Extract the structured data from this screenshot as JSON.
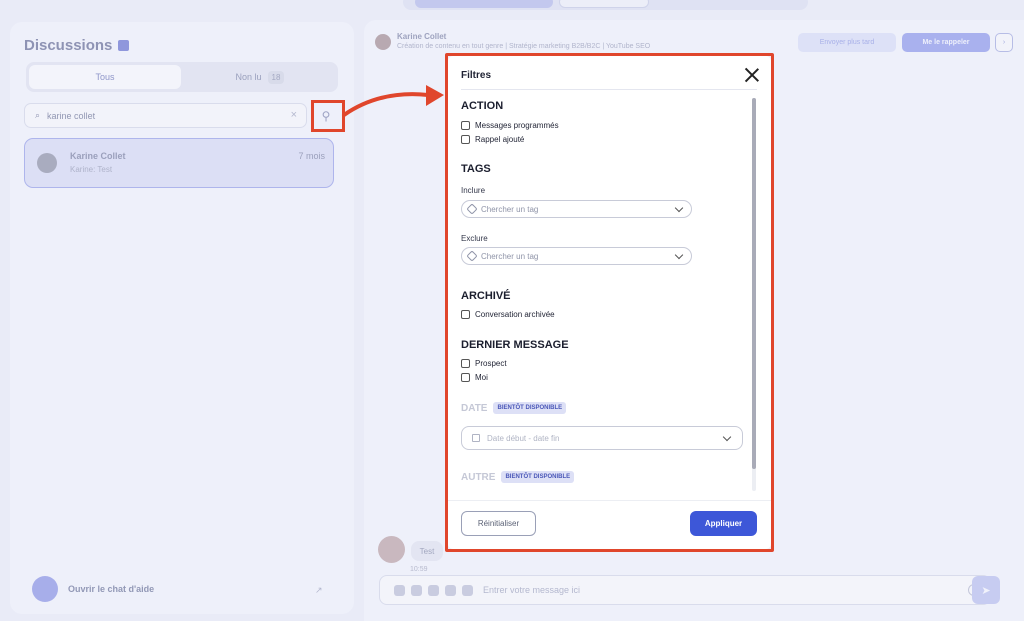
{
  "sidebar": {
    "title": "Discussions",
    "tabs": [
      {
        "label": "Tous"
      },
      {
        "label": "Non lu",
        "count": "18"
      }
    ],
    "search_value": "karine collet",
    "contact": {
      "name": "Karine Collet",
      "preview": "Karine: Test",
      "time": "7 mois"
    },
    "help_label": "Ouvrir le chat d'aide"
  },
  "chat": {
    "contact_name": "Karine Collet",
    "contact_subtitle": "Création de contenu en tout genre | Stratégie marketing B2B/B2C | YouTube SEO",
    "later_button": "Envoyer plus tard",
    "remind_button": "Me le rappeler",
    "message_text": "Test",
    "message_time": "10:59",
    "composer_placeholder": "Entrer votre message ici"
  },
  "filters": {
    "title": "Filtres",
    "action": {
      "title": "ACTION",
      "options": [
        "Messages programmés",
        "Rappel ajouté"
      ]
    },
    "tags": {
      "title": "TAGS",
      "include_label": "Inclure",
      "exclude_label": "Exclure",
      "search_placeholder": "Chercher un tag"
    },
    "archived": {
      "title": "ARCHIVÉ",
      "options": [
        "Conversation archivée"
      ]
    },
    "last_message": {
      "title": "DERNIER MESSAGE",
      "options": [
        "Prospect",
        "Moi"
      ]
    },
    "date": {
      "title": "DATE",
      "badge": "BIENTÔT DISPONIBLE",
      "placeholder": "Date début - date fin"
    },
    "other": {
      "title": "AUTRE",
      "badge": "BIENTÔT DISPONIBLE"
    },
    "reset_button": "Réinitialiser",
    "apply_button": "Appliquer"
  },
  "colors": {
    "highlight": "#e0462c",
    "primary": "#3d57d8",
    "badge_bg": "#dde0f6"
  }
}
